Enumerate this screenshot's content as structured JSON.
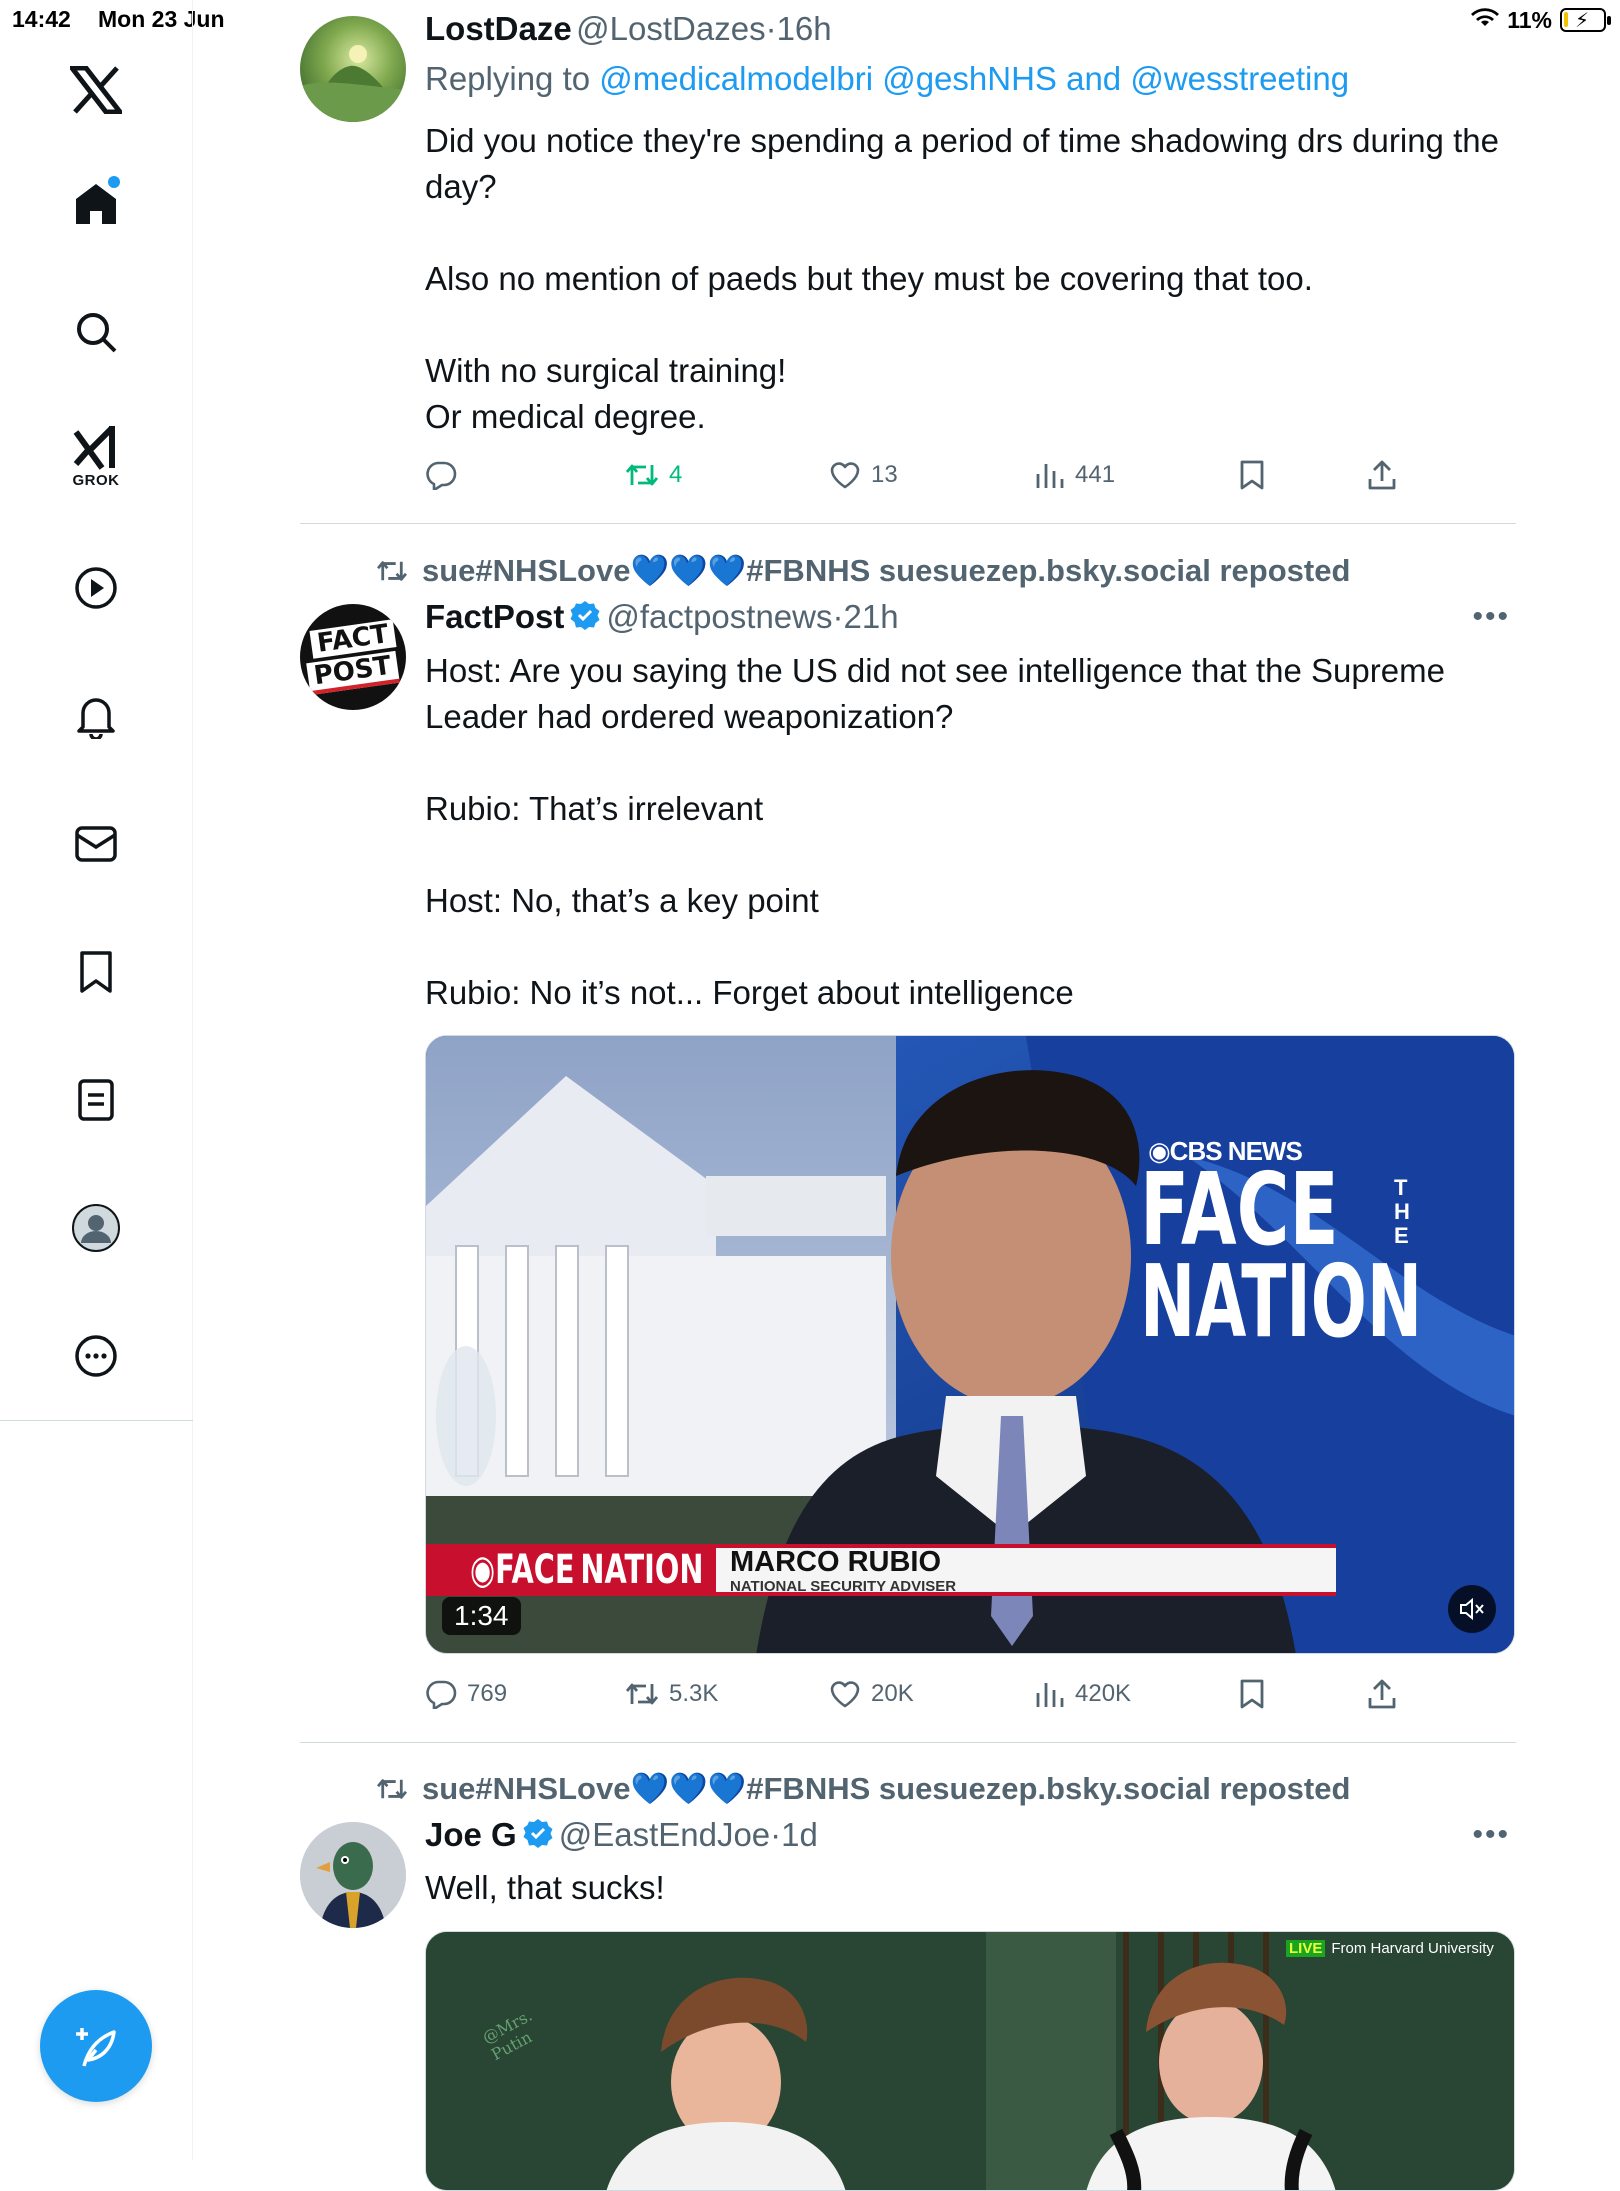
{
  "status_bar": {
    "time": "14:42",
    "date": "Mon 23 Jun",
    "battery": "11%",
    "battery_level": 0.11
  },
  "sidebar": {
    "items": [
      "home",
      "search",
      "grok",
      "videos",
      "notifications",
      "messages",
      "bookmarks",
      "lists",
      "profile",
      "more"
    ],
    "grok_label": "GROK"
  },
  "tweets": [
    {
      "name": "LostDaze",
      "handle": "@LostDazes",
      "time": "16h",
      "replying_prefix": "Replying to ",
      "replying_to": "@medicalmodelbri @geshNHS",
      "replying_and": " and ",
      "replying_to_2": "@wesstreeting",
      "text": "Did you notice they're spending a period of time shadowing drs during the day?\n\nAlso no mention of paeds but they must be covering that too.\n\nWith no surgical training!\nOr medical degree.",
      "replies": "",
      "reposts": "4",
      "likes": "13",
      "views": "441"
    },
    {
      "reposted_by": "sue#NHSLove💙💙💙#FBNHS suesuezep.bsky.social reposted",
      "name": "FactPost",
      "handle": "@factpostnews",
      "time": "21h",
      "avatar_text_1": "FACT",
      "avatar_text_2": "POST",
      "text": "Host: Are you saying the US did not see intelligence that the Supreme Leader had ordered weaponization?\n\nRubio: That’s irrelevant\n\nHost: No, that’s a key point\n\nRubio: No it’s not... Forget about intelligence",
      "video": {
        "network": "◉CBS NEWS",
        "show_line1": "FACE",
        "show_the": "THE",
        "show_line2": "NATION",
        "lower_third_logo": "◉FACE NATION",
        "guest_name": "MARCO RUBIO",
        "guest_title": "NATIONAL SECURITY ADVISER",
        "duration": "1:34"
      },
      "replies": "769",
      "reposts": "5.3K",
      "likes": "20K",
      "views": "420K"
    },
    {
      "reposted_by": "sue#NHSLove💙💙💙#FBNHS suesuezep.bsky.social reposted",
      "name": "Joe G",
      "handle": "@EastEndJoe",
      "time": "1d",
      "text": "Well, that sucks!",
      "image": {
        "live_badge": "LIVE",
        "overlay_text": "From Harvard University",
        "watermark": "@Mrs. Putin"
      }
    }
  ]
}
